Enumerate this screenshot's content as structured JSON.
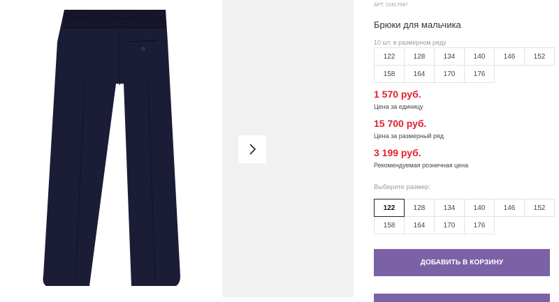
{
  "product": {
    "article_prefix": "АРТ.",
    "article_number": "22417047",
    "title": "Брюки для мальчика",
    "pack_note": "10 шт. в размерном ряду",
    "size_range": [
      "122",
      "128",
      "134",
      "140",
      "146",
      "152",
      "158",
      "164",
      "170",
      "176"
    ],
    "prices": [
      {
        "value": "1 570 руб.",
        "label": "Цена за единицу"
      },
      {
        "value": "15 700 руб.",
        "label": "Цена за размерный ряд"
      },
      {
        "value": "3 199 руб.",
        "label": "Рекомендуемая розничная цена"
      }
    ],
    "choose_size_label": "Выберите размер:",
    "selectable_sizes": [
      "122",
      "128",
      "134",
      "140",
      "146",
      "152",
      "158",
      "164",
      "170",
      "176"
    ],
    "selected_size": "122",
    "add_to_cart_label": "ДОБАВИТЬ В КОРЗИНУ"
  },
  "gallery": {
    "next_icon": "chevron-right-icon",
    "image_subject": "pants-product-image"
  },
  "colors": {
    "price": "#e0202e",
    "button": "#7b62a6",
    "gallery_bg": "#f1f1f1",
    "pants": "#1b1c35"
  }
}
